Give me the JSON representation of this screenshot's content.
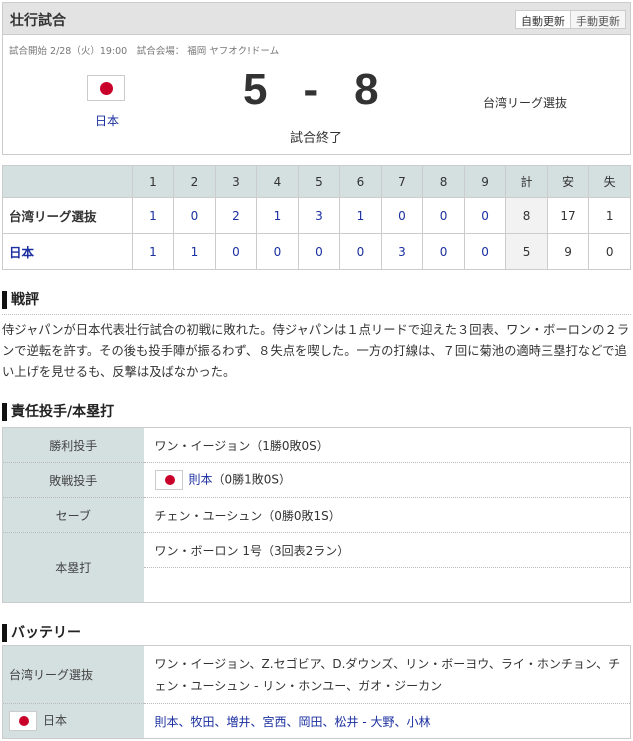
{
  "header": {
    "title": "壮行試合",
    "auto_update": "自動更新",
    "manual_update": "手動更新"
  },
  "game": {
    "meta": "試合開始 2/28（火）19:00　試合会場： 福岡 ヤフオク!ドーム",
    "home_team": "日本",
    "away_team": "台湾リーグ選抜",
    "home_score": "5",
    "separator": "-",
    "away_score": "8",
    "status": "試合終了",
    "flag_color": "#c8002a"
  },
  "linescore": {
    "headers": [
      "1",
      "2",
      "3",
      "4",
      "5",
      "6",
      "7",
      "8",
      "9",
      "計",
      "安",
      "失"
    ],
    "rows": [
      {
        "team": "台湾リーグ選抜",
        "innings": [
          "1",
          "0",
          "2",
          "1",
          "3",
          "1",
          "0",
          "0",
          "0"
        ],
        "total": "8",
        "hits": "17",
        "errors": "1"
      },
      {
        "team": "日本",
        "innings": [
          "1",
          "1",
          "0",
          "0",
          "0",
          "0",
          "3",
          "0",
          "0"
        ],
        "total": "5",
        "hits": "9",
        "errors": "0"
      }
    ]
  },
  "review": {
    "heading": "戦評",
    "text": "侍ジャパンが日本代表壮行試合の初戦に敗れた。侍ジャパンは１点リードで迎えた３回表、ワン・ボーロンの２ランで逆転を許す。その後も投手陣が振るわず、８失点を喫した。一方の打線は、７回に菊池の適時三塁打などで追い上げを見せるも、反撃は及ばなかった。"
  },
  "pitchers": {
    "heading": "責任投手/本塁打",
    "win_label": "勝利投手",
    "win_value": "ワン・イージョン（1勝0敗0S）",
    "loss_label": "敗戦投手",
    "loss_name": "則本",
    "loss_record": "（0勝1敗0S）",
    "save_label": "セーブ",
    "save_value": "チェン・ユーシュン（0勝0敗1S）",
    "hr_label": "本塁打",
    "hr_value": "ワン・ボーロン 1号（3回表2ラン）"
  },
  "battery": {
    "heading": "バッテリー",
    "away_label": "台湾リーグ選抜",
    "away_value": "ワン・イージョン、Z.セゴビア、D.ダウンズ、リン・ボーヨウ、ライ・ホンチョン、チェン・ユーシュン - リン・ホンユー、ガオ・ジーカン",
    "home_label": "日本",
    "home_value": "則本、牧田、増井、宮西、岡田、松井 - 大野、小林"
  }
}
